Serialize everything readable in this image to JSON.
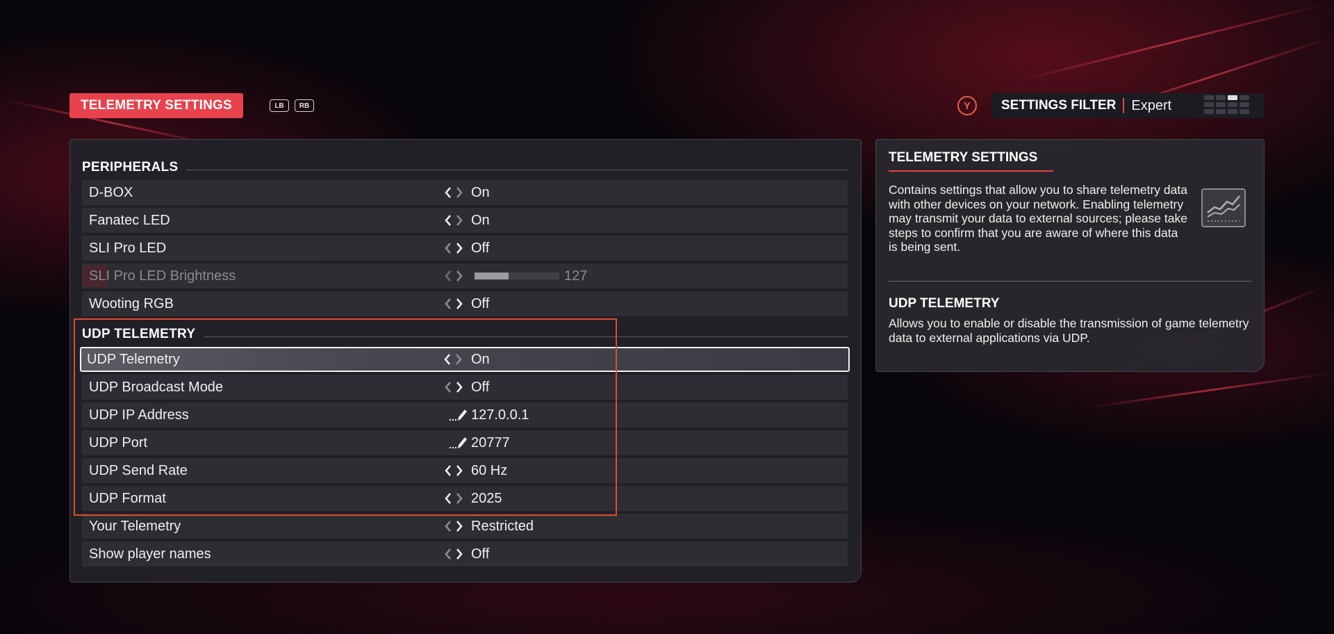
{
  "header": {
    "title": "TELEMETRY SETTINGS",
    "bumpers": [
      "LB",
      "RB"
    ],
    "filter_button": "Y",
    "filter_label": "SETTINGS FILTER",
    "filter_value": "Expert"
  },
  "sections": {
    "peripherals": {
      "title": "PERIPHERALS",
      "rows": [
        {
          "label": "D-BOX",
          "value": "On"
        },
        {
          "label": "Fanatec LED",
          "value": "On"
        },
        {
          "label": "SLI Pro LED",
          "value": "Off"
        },
        {
          "label": "SLI Pro LED Brightness",
          "value": "127",
          "slider_fraction": 0.4
        },
        {
          "label": "Wooting RGB",
          "value": "Off"
        }
      ]
    },
    "udp": {
      "title": "UDP TELEMETRY",
      "rows": [
        {
          "label": "UDP Telemetry",
          "value": "On"
        },
        {
          "label": "UDP Broadcast Mode",
          "value": "Off"
        },
        {
          "label": "UDP IP Address",
          "value": "127.0.0.1"
        },
        {
          "label": "UDP Port",
          "value": "20777"
        },
        {
          "label": "UDP Send Rate",
          "value": "60 Hz"
        },
        {
          "label": "UDP Format",
          "value": "2025"
        },
        {
          "label": "Your Telemetry",
          "value": "Restricted"
        },
        {
          "label": "Show player names",
          "value": "Off"
        }
      ]
    }
  },
  "info": {
    "title": "TELEMETRY SETTINGS",
    "description": "Contains settings that allow you to share telemetry data with other devices on your network. Enabling telemetry may transmit your data to external sources; please take steps to confirm that you are aware of where this data is being sent.",
    "icon": "telemetry-graph-icon",
    "sub_title": "UDP TELEMETRY",
    "sub_description": "Allows you to enable or disable the transmission of game telemetry data to external applications via UDP."
  },
  "colors": {
    "accent": "#e8424c",
    "highlight_border": "#d9502f",
    "panel": "#222228",
    "row": "#2d2d33"
  }
}
